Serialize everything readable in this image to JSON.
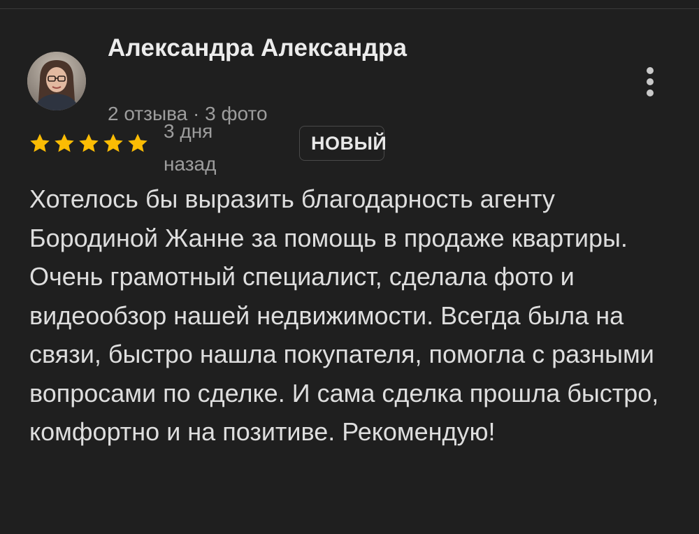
{
  "review": {
    "author_name": "Александра Александра",
    "author_meta": "2 отзыва · 3 фото",
    "rating": 5,
    "rating_max": 5,
    "date": "3 дня назад",
    "badge": "НОВЫЙ",
    "text": "Хотелось бы выразить благодарность агенту Бородиной Жанне за помощь в продаже квартиры. Очень грамотный специалист, сделала фото и видеообзор нашей недвижимости. Всегда была на связи, быстро нашла покупателя, помогла с разными вопросами по сделке. И сама сделка прошла быстро, комфортно и на позитиве. Рекомендую!"
  },
  "icons": {
    "more": "more-vert-icon",
    "star": "star-icon"
  },
  "colors": {
    "background": "#1f1f1f",
    "star": "#fbbc04",
    "text": "#dedede",
    "muted": "#9d9d9d"
  }
}
